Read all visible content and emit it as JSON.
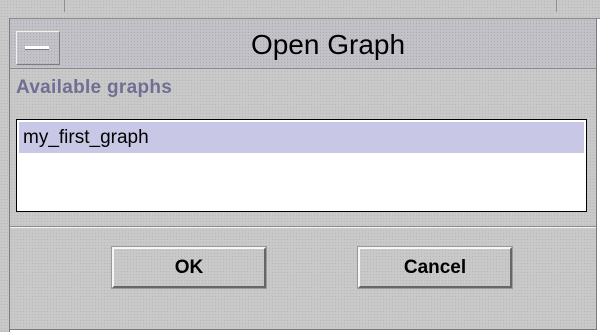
{
  "dialog": {
    "title": "Open Graph",
    "section_label": "Available graphs",
    "graphs": [
      {
        "label": "my_first_graph",
        "selected": true
      }
    ],
    "ok_label": "OK",
    "cancel_label": "Cancel"
  },
  "colors": {
    "selection": "#c8c8e6",
    "section_label": "#6f6f95",
    "panel": "#c9c9c9"
  },
  "icons": {
    "window_menu": "window-menu-dash-icon"
  }
}
